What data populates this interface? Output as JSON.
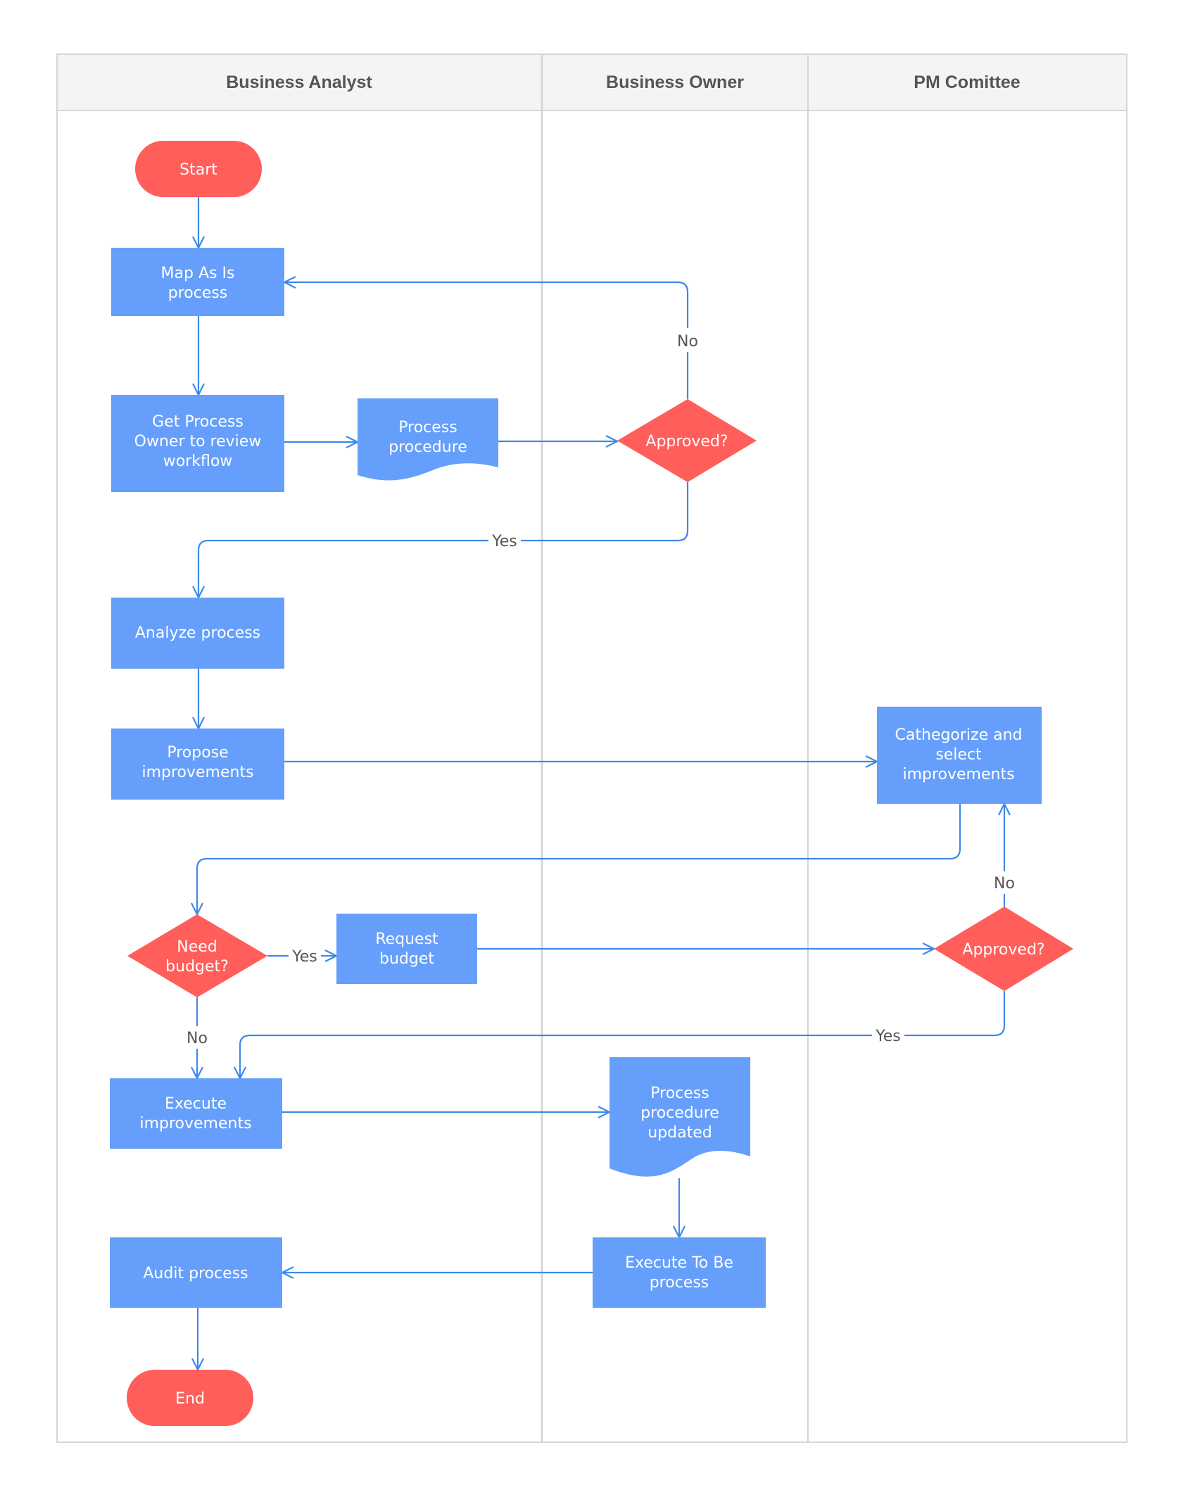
{
  "colors": {
    "process": "#659FFB",
    "terminal": "#FF5E5A",
    "decision": "#FF5E5A",
    "connector": "#3F88E8",
    "lane_header_bg": "#F4F4F4",
    "lane_border": "#D6D6D6",
    "label_text": "#555555"
  },
  "lanes": [
    {
      "id": "ba",
      "title": "Business Analyst"
    },
    {
      "id": "bo",
      "title": "Business Owner"
    },
    {
      "id": "pm",
      "title": "PM Comittee"
    }
  ],
  "nodes": [
    {
      "id": "start",
      "type": "terminal",
      "lane": "ba",
      "lines": [
        "Start"
      ]
    },
    {
      "id": "map",
      "type": "process",
      "lane": "ba",
      "lines": [
        "Map As Is",
        "process"
      ]
    },
    {
      "id": "getowner",
      "type": "process",
      "lane": "ba",
      "lines": [
        "Get Process",
        "Owner to review",
        "workflow"
      ]
    },
    {
      "id": "doc1",
      "type": "document",
      "lane": "ba",
      "lines": [
        "Process",
        "procedure"
      ]
    },
    {
      "id": "approved1",
      "type": "decision",
      "lane": "bo",
      "lines": [
        "Approved?"
      ]
    },
    {
      "id": "analyze",
      "type": "process",
      "lane": "ba",
      "lines": [
        "Analyze process"
      ]
    },
    {
      "id": "propose",
      "type": "process",
      "lane": "ba",
      "lines": [
        "Propose",
        "improvements"
      ]
    },
    {
      "id": "categorize",
      "type": "process",
      "lane": "pm",
      "lines": [
        "Cathegorize and",
        "select",
        "improvements"
      ]
    },
    {
      "id": "needbudget",
      "type": "decision",
      "lane": "ba",
      "lines": [
        "Need",
        "budget?"
      ]
    },
    {
      "id": "request",
      "type": "process",
      "lane": "ba",
      "lines": [
        "Request",
        "budget"
      ]
    },
    {
      "id": "approved2",
      "type": "decision",
      "lane": "pm",
      "lines": [
        "Approved?"
      ]
    },
    {
      "id": "execute",
      "type": "process",
      "lane": "ba",
      "lines": [
        "Execute",
        "improvements"
      ]
    },
    {
      "id": "doc2",
      "type": "document",
      "lane": "bo",
      "lines": [
        "Process",
        "procedure",
        "updated"
      ]
    },
    {
      "id": "tobe",
      "type": "process",
      "lane": "bo",
      "lines": [
        "Execute To Be",
        "process"
      ]
    },
    {
      "id": "audit",
      "type": "process",
      "lane": "ba",
      "lines": [
        "Audit process"
      ]
    },
    {
      "id": "end",
      "type": "terminal",
      "lane": "ba",
      "lines": [
        "End"
      ]
    }
  ],
  "edges": [
    {
      "from": "start",
      "to": "map",
      "label": ""
    },
    {
      "from": "map",
      "to": "getowner",
      "label": ""
    },
    {
      "from": "getowner",
      "to": "doc1",
      "label": ""
    },
    {
      "from": "doc1",
      "to": "approved1",
      "label": ""
    },
    {
      "from": "approved1",
      "to": "map",
      "label": "No"
    },
    {
      "from": "approved1",
      "to": "analyze",
      "label": "Yes"
    },
    {
      "from": "analyze",
      "to": "propose",
      "label": ""
    },
    {
      "from": "propose",
      "to": "categorize",
      "label": ""
    },
    {
      "from": "categorize",
      "to": "needbudget",
      "label": ""
    },
    {
      "from": "needbudget",
      "to": "request",
      "label": "Yes"
    },
    {
      "from": "needbudget",
      "to": "execute",
      "label": "No"
    },
    {
      "from": "request",
      "to": "approved2",
      "label": ""
    },
    {
      "from": "approved2",
      "to": "categorize",
      "label": "No"
    },
    {
      "from": "approved2",
      "to": "execute",
      "label": "Yes"
    },
    {
      "from": "execute",
      "to": "doc2",
      "label": ""
    },
    {
      "from": "doc2",
      "to": "tobe",
      "label": ""
    },
    {
      "from": "tobe",
      "to": "audit",
      "label": ""
    },
    {
      "from": "audit",
      "to": "end",
      "label": ""
    }
  ]
}
